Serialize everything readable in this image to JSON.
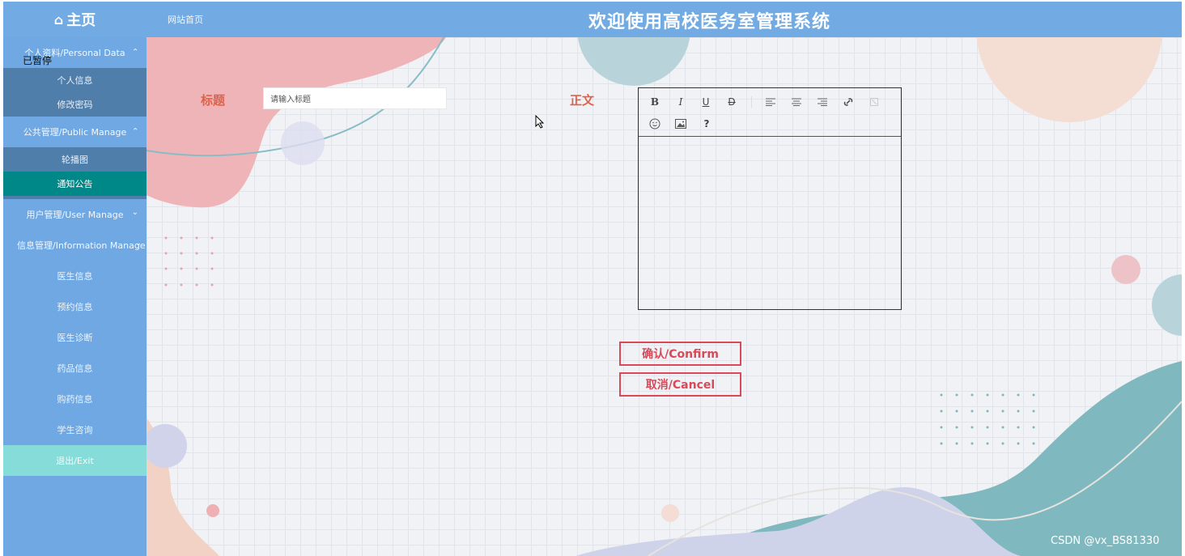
{
  "topbar": {
    "home_label": "主页",
    "site_home": "网站首页",
    "app_title": "欢迎使用高校医务室管理系统"
  },
  "overlay": {
    "paused": "已暂停"
  },
  "sidebar": {
    "group1": {
      "label": "个人资料/Personal Data",
      "items": [
        "个人信息",
        "修改密码"
      ]
    },
    "group2": {
      "label": "公共管理/Public Manage",
      "items": [
        "轮播图",
        "通知公告"
      ],
      "active": "通知公告"
    },
    "group3": {
      "label": "用户管理/User Manage"
    },
    "group4": {
      "label": "信息管理/Information Manage"
    },
    "links": [
      "医生信息",
      "预约信息",
      "医生诊断",
      "药品信息",
      "购药信息",
      "学生咨询"
    ],
    "exit": "退出/Exit"
  },
  "form": {
    "title_label": "标题",
    "title_placeholder": "请输入标题",
    "body_label": "正文",
    "confirm": "确认/Confirm",
    "cancel": "取消/Cancel"
  },
  "editor_tools": [
    "bold",
    "italic",
    "underline",
    "strikethrough",
    "align-left",
    "align-center",
    "align-right",
    "link",
    "unlink",
    "emoji",
    "image",
    "help"
  ],
  "watermark": "CSDN @vx_BS81330",
  "colors": {
    "topbar": "#72abe3",
    "sidebar": "#6fa8e2",
    "submenu": "#4f7eab",
    "active": "#008787",
    "exit": "#86dcd8",
    "label": "#e06149",
    "button": "#d94958"
  }
}
